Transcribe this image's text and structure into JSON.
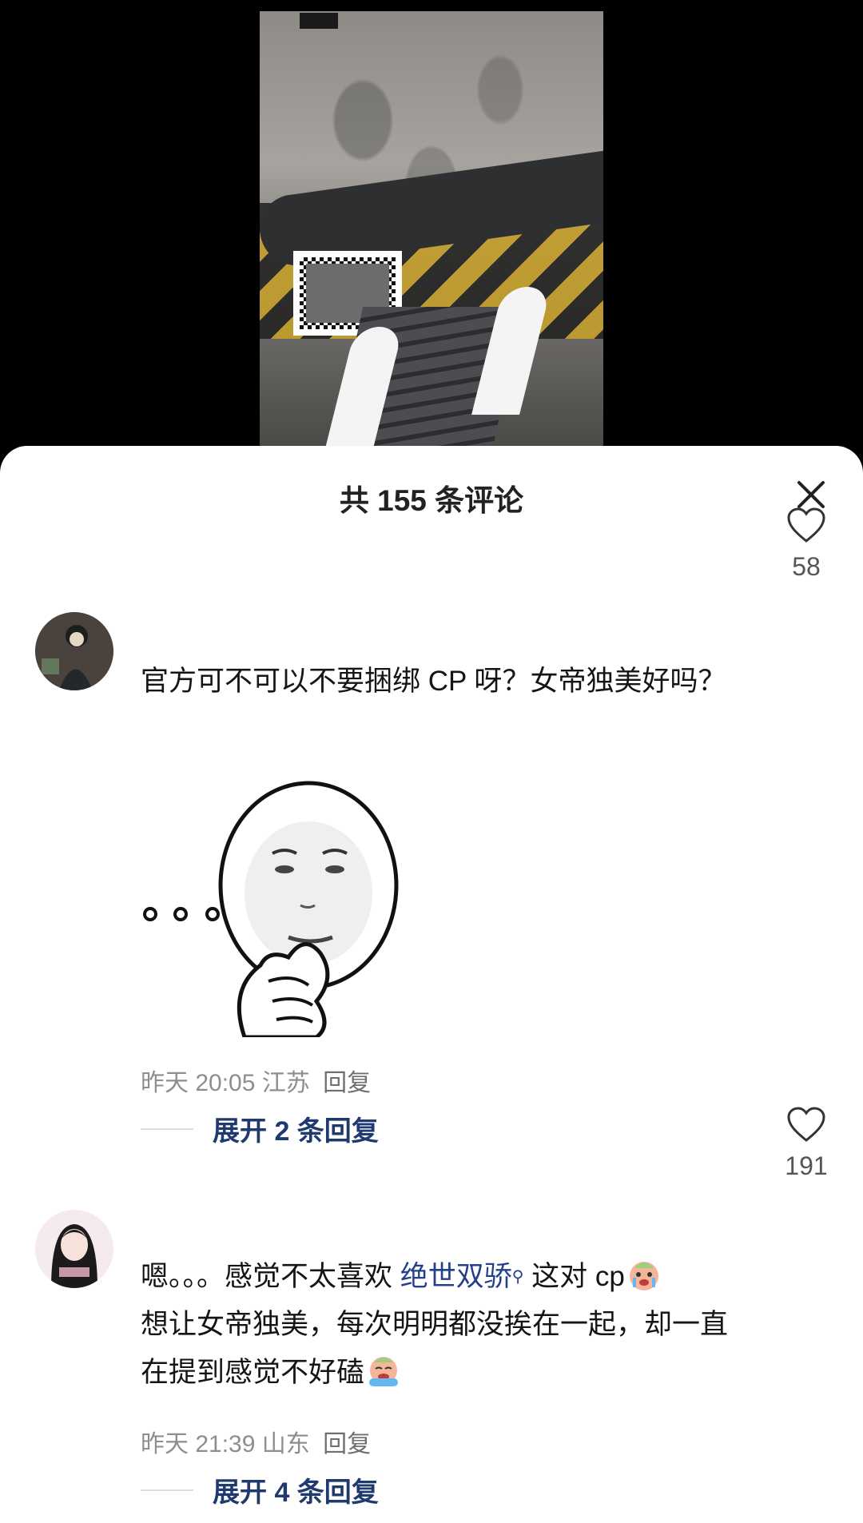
{
  "video": {
    "logo_text": "",
    "colors": {
      "wall": "#8e8b86",
      "stripe_yellow": "#c9a227",
      "stripe_dark": "#1f1f1f"
    }
  },
  "sheet": {
    "title": "共 155 条评论",
    "close_icon": "close-icon"
  },
  "comments": [
    {
      "text": "官方可不可以不要捆绑 CP 呀？女帝独美好吗？",
      "has_sticker": true,
      "time": "昨天 20:05",
      "location": "江苏",
      "reply_label": "回复",
      "expand_label": "展开 2 条回复",
      "likes": "58"
    },
    {
      "text_before": "嗯。。。感觉不太喜欢 ",
      "mention": "绝世双骄",
      "text_after_mention": " 这对 cp",
      "text_line2": "想让女帝独美，每次明明都没挨在一起，却一直在提到感觉不好磕",
      "time": "昨天 21:39",
      "location": "山东",
      "reply_label": "回复",
      "expand_label": "展开 4 条回复",
      "likes": "191"
    }
  ],
  "accent_colors": {
    "mention": "#24408c",
    "expand": "#1f3a6e",
    "meta": "#8e8e8e"
  }
}
